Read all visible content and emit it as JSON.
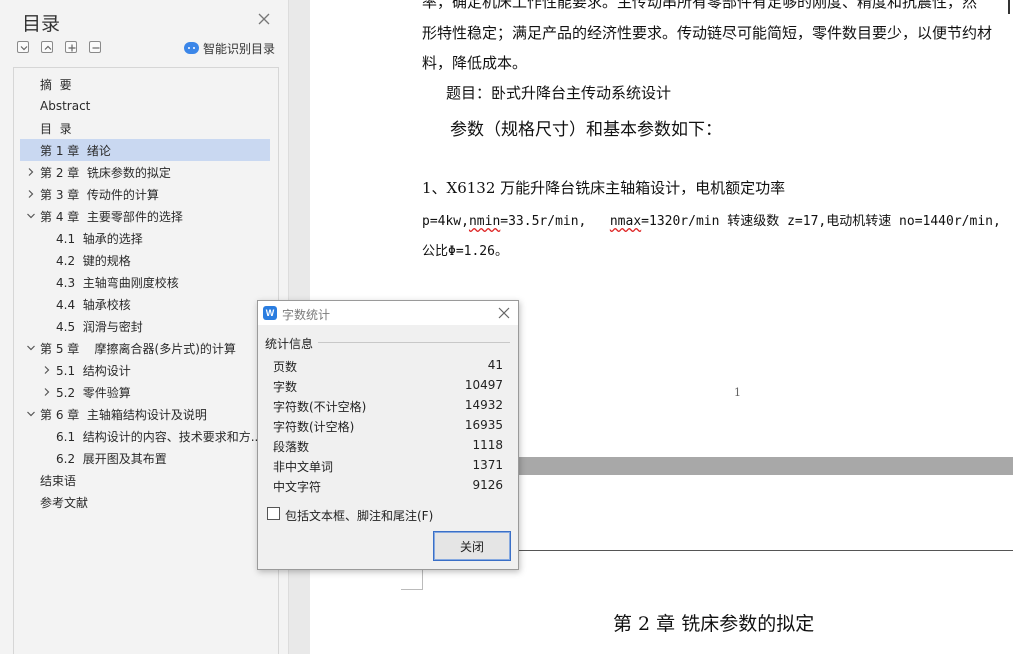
{
  "toc": {
    "title": "目录",
    "smart_label": "智能识别目录",
    "items": [
      {
        "label": "摘  要",
        "level": 0,
        "chevron": "none"
      },
      {
        "label": "Abstract",
        "level": 0,
        "chevron": "none"
      },
      {
        "label": "目  录",
        "level": 0,
        "chevron": "none"
      },
      {
        "label": "第 1 章  绪论",
        "level": 0,
        "chevron": "none",
        "selected": true
      },
      {
        "label": "第 2 章  铣床参数的拟定",
        "level": 0,
        "chevron": "right"
      },
      {
        "label": "第 3 章  传动件的计算",
        "level": 0,
        "chevron": "right"
      },
      {
        "label": "第 4 章  主要零部件的选择",
        "level": 0,
        "chevron": "down"
      },
      {
        "label": "4.1  轴承的选择",
        "level": 1,
        "chevron": "none"
      },
      {
        "label": "4.2  键的规格",
        "level": 1,
        "chevron": "none"
      },
      {
        "label": "4.3  主轴弯曲刚度校核",
        "level": 1,
        "chevron": "none"
      },
      {
        "label": "4.4  轴承校核",
        "level": 1,
        "chevron": "none"
      },
      {
        "label": "4.5  润滑与密封",
        "level": 1,
        "chevron": "none"
      },
      {
        "label": "第 5 章    摩擦离合器(多片式)的计算",
        "level": 0,
        "chevron": "down"
      },
      {
        "label": "5.1  结构设计",
        "level": 1,
        "chevron": "right"
      },
      {
        "label": "5.2  零件验算",
        "level": 1,
        "chevron": "right"
      },
      {
        "label": "第 6 章  主轴箱结构设计及说明",
        "level": 0,
        "chevron": "down"
      },
      {
        "label": "6.1  结构设计的内容、技术要求和方...",
        "level": 1,
        "chevron": "none"
      },
      {
        "label": "6.2  展开图及其布置",
        "level": 1,
        "chevron": "none"
      },
      {
        "label": "结束语",
        "level": 0,
        "chevron": "none"
      },
      {
        "label": "参考文献",
        "level": 0,
        "chevron": "none"
      }
    ]
  },
  "document": {
    "line1": "率，确定机床工作性能要求。主传动串所有零部件有足够的刚度、精度和抗震性，然",
    "line2": "形特性稳定；满足产品的经济性要求。传动链尽可能简短，零件数目要少，以便节约材",
    "line3": "料，降低成本。",
    "line4": "题目：卧式升降台主传动系统设计",
    "line5": "参数（规格尺寸）和基本参数如下：",
    "line6": "1、X6132 万能升降台铣床主轴箱设计，电机额定功率",
    "line7_a": "p=4kw,",
    "line7_b": "nmin",
    "line7_c": "=33.5r/min,   ",
    "line7_d": "nmax",
    "line7_e": "=1320r/min 转速级数 z=17,电动机转速 no=1440r/min,",
    "line8": "公比Φ=1.26。",
    "page_number": "1",
    "chapter2_heading": "第 2 章  铣床参数的拟定"
  },
  "word_count_dialog": {
    "title": "字数统计",
    "app_icon": "W",
    "section_title": "统计信息",
    "rows": [
      {
        "label": "页数",
        "value": "41"
      },
      {
        "label": "字数",
        "value": "10497"
      },
      {
        "label": "字符数(不计空格)",
        "value": "14932"
      },
      {
        "label": "字符数(计空格)",
        "value": "16935"
      },
      {
        "label": "段落数",
        "value": "1118"
      },
      {
        "label": "非中文单词",
        "value": "1371"
      },
      {
        "label": "中文字符",
        "value": "9126"
      }
    ],
    "checkbox_label": "包括文本框、脚注和尾注(F)",
    "checkbox_checked": false,
    "close_button": "关闭"
  },
  "colors": {
    "accent": "#3b86e8",
    "selected_row": "#c9d8f1",
    "spell_error": "#d22"
  }
}
